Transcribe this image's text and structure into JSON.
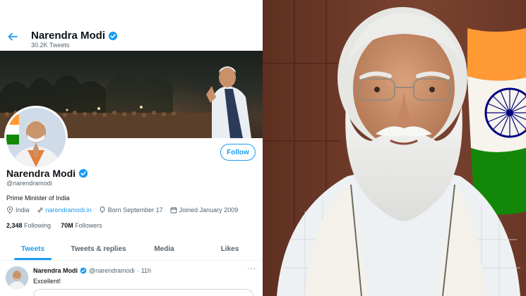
{
  "twitter": {
    "header": {
      "name": "Narendra Modi",
      "tweet_count": "30.2K Tweets"
    },
    "profile": {
      "name": "Narendra Modi",
      "handle": "@narendramodi",
      "bio": "Prime Minister of India",
      "follow_label": "Follow",
      "location": "India",
      "website": "narendramodi.in",
      "born": "Born September 17",
      "joined": "Joined January 2009",
      "following_count": "2,348",
      "following_label": "Following",
      "followers_count": "70M",
      "followers_label": "Followers"
    },
    "tabs": [
      {
        "label": "Tweets",
        "active": true
      },
      {
        "label": "Tweets & replies",
        "active": false
      },
      {
        "label": "Media",
        "active": false
      },
      {
        "label": "Likes",
        "active": false
      }
    ],
    "tweet": {
      "name": "Narendra Modi",
      "handle": "@narendramodi",
      "separator": "·",
      "time": "11h",
      "text": "Excellent!",
      "more": "···"
    }
  },
  "colors": {
    "accent": "#1d9bf0",
    "text_primary": "#0f1419",
    "text_secondary": "#536471",
    "saffron": "#ff9933",
    "india_green": "#138808",
    "ashoka_blue": "#000080"
  }
}
